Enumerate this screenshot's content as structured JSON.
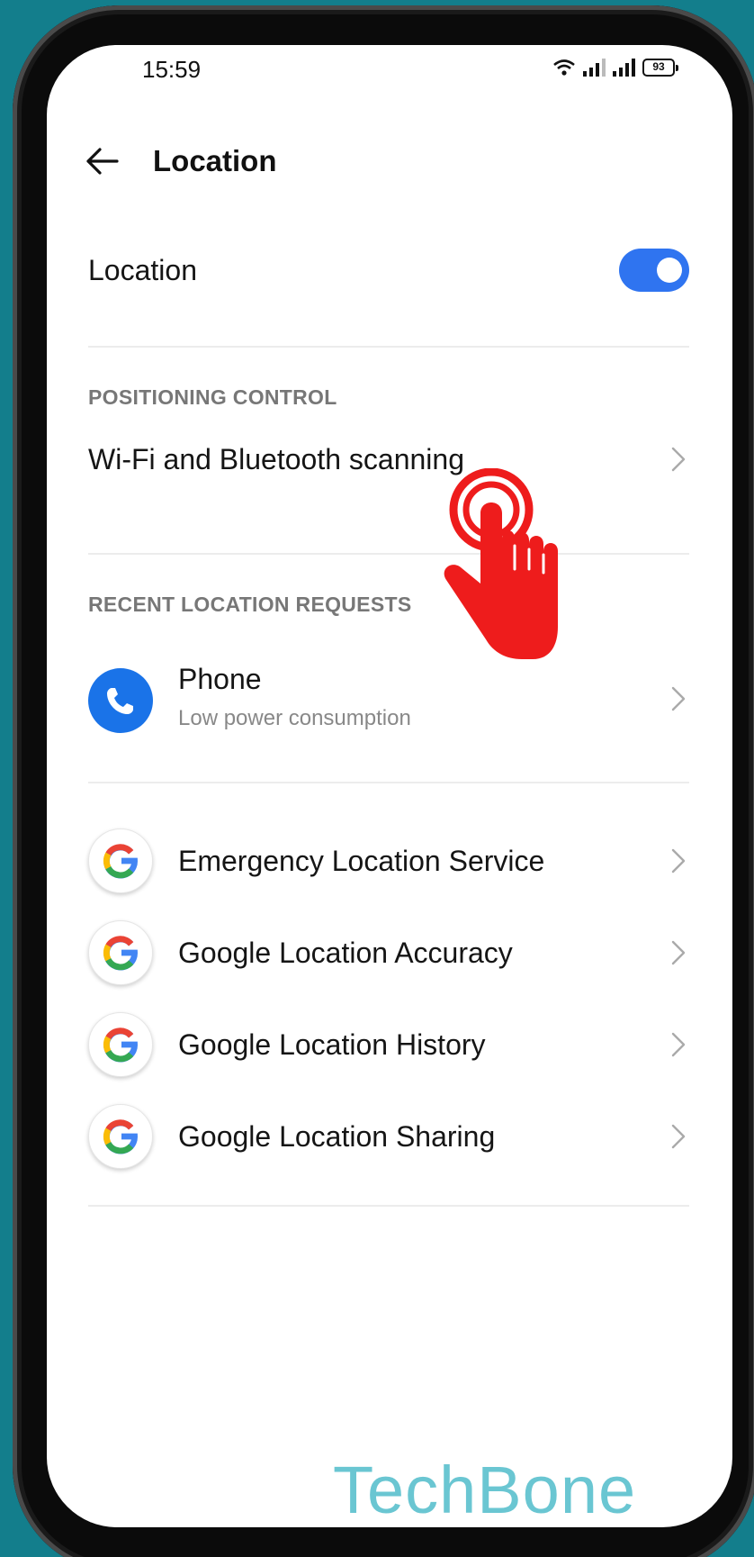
{
  "status_bar": {
    "time": "15:59",
    "battery": "93"
  },
  "header": {
    "title": "Location"
  },
  "location_toggle": {
    "label": "Location",
    "enabled": true
  },
  "positioning_control": {
    "header": "POSITIONING CONTROL",
    "wifi_bt_scanning": "Wi-Fi and Bluetooth scanning"
  },
  "recent_requests": {
    "header": "RECENT LOCATION REQUESTS",
    "items": [
      {
        "title": "Phone",
        "subtitle": "Low power consumption",
        "icon": "phone-icon"
      }
    ]
  },
  "services": [
    {
      "label": "Emergency Location Service",
      "icon": "google-icon"
    },
    {
      "label": "Google Location Accuracy",
      "icon": "google-icon"
    },
    {
      "label": "Google Location History",
      "icon": "google-icon"
    },
    {
      "label": "Google Location Sharing",
      "icon": "google-icon"
    }
  ],
  "watermark": "TechBone",
  "colors": {
    "accent": "#2f74f0",
    "background": "#137e8c",
    "tap_hand": "#ee1c1c"
  }
}
